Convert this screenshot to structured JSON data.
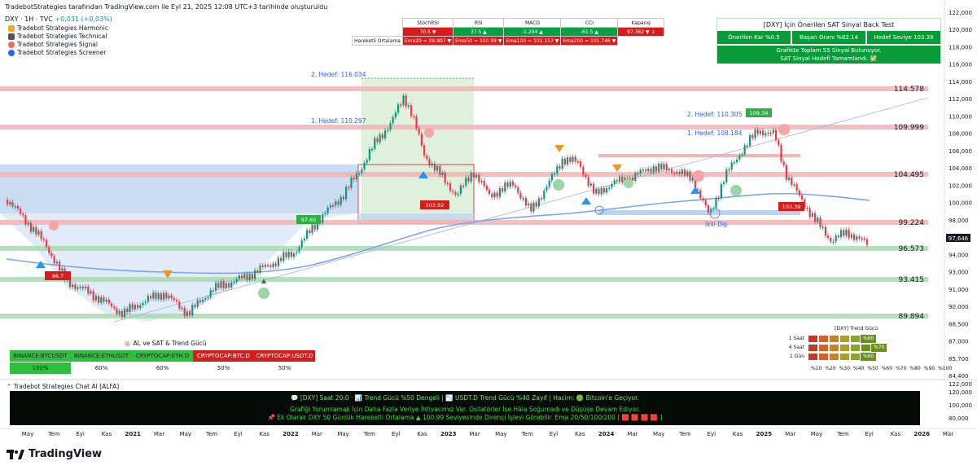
{
  "header": {
    "line1": "TradebotStrategies tarafından TradingView.com ile Eyl 21, 2025 12:08 UTC+3 tarihinde oluşturuldu",
    "symbol_line": "DXY · 1H · TVC",
    "change": "+0,031 (+0,03%)"
  },
  "indicators": [
    {
      "label": "Tradebot Strategies Harmonic",
      "icon": "harmonic-icon",
      "color": "#f5a623"
    },
    {
      "label": "Tradebot Strategies Technical",
      "icon": "technical-icon",
      "color": "#333333"
    },
    {
      "label": "Tradebot Strategies Signal",
      "icon": "signal-icon",
      "color": "#f06a6a"
    },
    {
      "label": "Tradebot Strategies Screener",
      "icon": "screener-icon",
      "color": "#2962ff"
    }
  ],
  "metrics_table": {
    "headers": [
      "StochRSI",
      "RSI",
      "MACD",
      "CCI",
      "Kapanış"
    ],
    "values": [
      "70.5 ▼",
      "37.5 ▲",
      "-1.294 ▲",
      "-61.5 ▲",
      "97.362 ▼ ↓"
    ],
    "value_status": [
      "red",
      "green",
      "green",
      "green",
      "red"
    ],
    "ma_label": "Hareketli Ortalama",
    "ma_values": [
      "Ema20 = 98.807 ▼",
      "Ema50 = 100.99 ▼",
      "Ema100 = 102.152 ▼",
      "Ema200 = 101.746 ▼"
    ]
  },
  "backtest": {
    "title": "[DXY] İçin Önerilen SAT Sinyal Back Test",
    "cells": [
      "Önerilen Kar %0.5",
      "Başarı Oranı %82.14",
      "Hedef Seviye 103.39"
    ],
    "message_line1": "Grafikte Toplam 55 Sinyal Bulunuyor.",
    "message_line2": "SAT Sinyal Hedefi Tamamlandı. ✅"
  },
  "price_axis": [
    "122,000",
    "120,000",
    "118,000",
    "116,000",
    "114,000",
    "112,000",
    "110,000",
    "108,000",
    "106,000",
    "104,000",
    "102,000",
    "100,000",
    "98,000",
    "96,000",
    "94,000",
    "93,000",
    "91,000",
    "90,000",
    "88,500",
    "87,000",
    "85,700",
    "84,400"
  ],
  "current_price": "97,646",
  "levels": [
    {
      "label": "114.578",
      "color": "#f2b4b4"
    },
    {
      "label": "109.999",
      "color": "#f2b4b4"
    },
    {
      "label": "104.495",
      "color": "#f2b4b4"
    },
    {
      "label": "99.224",
      "color": "#f2b4b4"
    },
    {
      "label": "96.573",
      "color": "#a8dbb0"
    },
    {
      "label": "93.415",
      "color": "#a8dbb0"
    },
    {
      "label": "89.894",
      "color": "#a8dbb0"
    }
  ],
  "targets": {
    "t2a": "2. Hedef: 116.034",
    "t1a": "1. Hedef: 110.297",
    "t2b": "2. Hedef: 110.305",
    "t1b": "1. Hedef: 108.184",
    "ikili": "İkili Dip"
  },
  "signal_labels": [
    "97.60",
    "96.7",
    "103.92",
    "109.34",
    "103.39"
  ],
  "time_axis": [
    "May",
    "Tem",
    "Eyl",
    "Kas",
    "2021",
    "Mar",
    "May",
    "Tem",
    "Eyl",
    "Kas",
    "2022",
    "Mar",
    "May",
    "Tem",
    "Eyl",
    "Kas",
    "2023",
    "Mar",
    "May",
    "Tem",
    "Eyl",
    "Kas",
    "2024",
    "Mar",
    "May",
    "Tem",
    "Eyl",
    "Kas",
    "2025",
    "Mar",
    "May",
    "Tem",
    "Eyl",
    "Kas",
    "2026",
    "Mar"
  ],
  "watch": {
    "title": "AL ve SAT & Trend Gücü",
    "symbols": [
      "BINANCE:BTCUSDT",
      "BINANCE:ETHUSDT",
      "CRYPTOCAP:ETH.D",
      "CRYPTOCAP:BTC.D",
      "CRYPTOCAP:USDT.D"
    ],
    "values": [
      "100%",
      "60%",
      "60%",
      "50%",
      "50%"
    ],
    "status": [
      "green",
      "green",
      "green",
      "red",
      "red"
    ]
  },
  "trend_gucu": {
    "title": "[DXY] Trend Gücü",
    "rows": [
      {
        "label": "1 Saat",
        "value": "%60"
      },
      {
        "label": "4 Saat",
        "value": "%70"
      },
      {
        "label": "1 Gün",
        "value": "%60"
      }
    ],
    "scale": [
      "%10",
      "%20",
      "%30",
      "%40",
      "%50",
      "%60",
      "%70",
      "%80",
      "%90",
      "%100"
    ]
  },
  "sub_title": "Tradebot Strategies Chat AI [ALFA]",
  "sub_axis": [
    "122,000",
    "120,000",
    "100,000",
    "80,000"
  ],
  "chat_panel": {
    "line1": "💬 [DXY] Saat 20:0 · 📊 Trend Gücü %50 Dengeli | 📉 USDT.D Trend Gücü %40 Zayıf | Hacim: 🟢 Bitcoin'e Geçiyor.",
    "line2": "Grafiği Yorumlamak İçin Daha Fazla Veriye İhtiyacımız Var. Osilatörler İse Hâla Soğumadı ve Düşüşe Devam Ediyor.",
    "line3": "📌 Ek Olarak DXY 50 Günlük Hareketli Ortalama ▲ 100.99 Seviyesinde Dirençi İşlevi Görebilir. Ema 20/50/100/200 [ 🟥 🟥 🟥 🟥 ]"
  },
  "footer": {
    "brand": "TradingView"
  },
  "colors": {
    "up": "#089981",
    "down": "#f23645",
    "ma": "#7aa3f5",
    "accent": "#2962ff"
  }
}
